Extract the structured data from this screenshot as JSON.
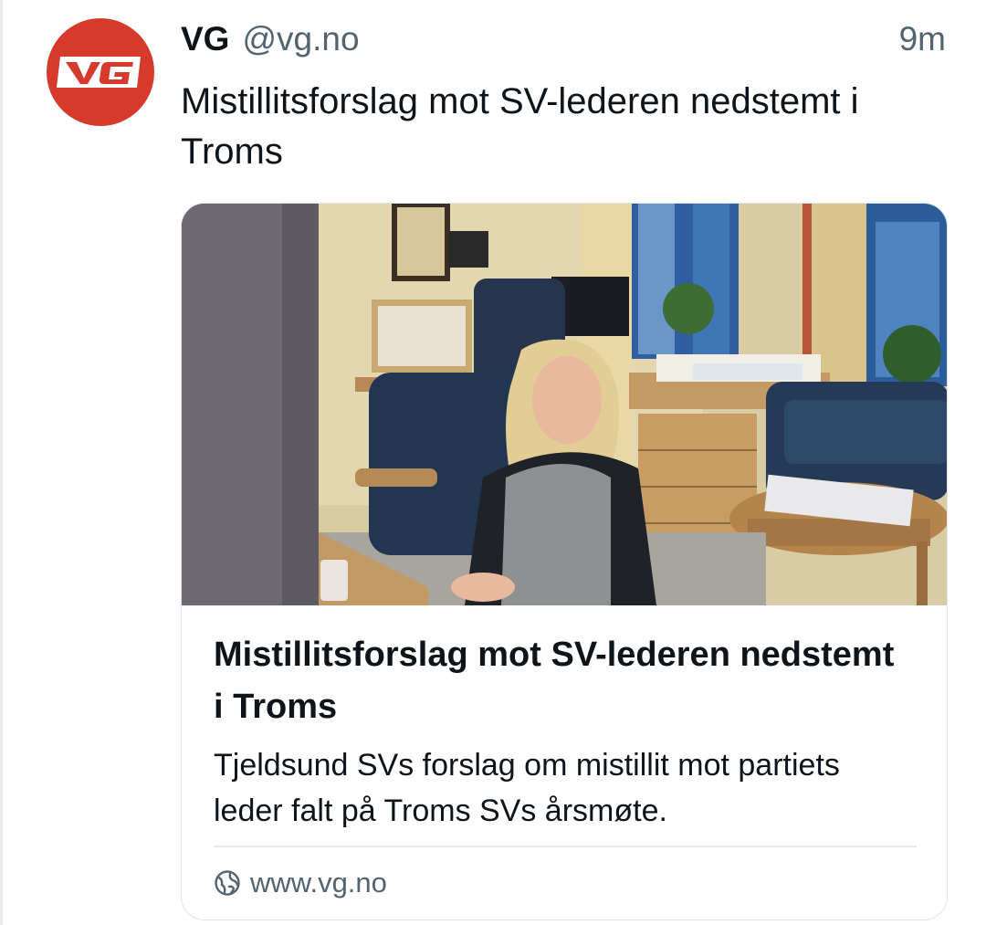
{
  "author": {
    "name": "VG",
    "handle": "@vg.no",
    "avatar_logo": "VG",
    "avatar_color": "#d63a2c"
  },
  "post": {
    "time": "9m",
    "text": "Mistillitsforslag mot SV-lederen nedstemt i Troms"
  },
  "link_card": {
    "image_description_icon": "photo",
    "title": "Mistillitsforslag mot SV-lederen nedstemt i Troms",
    "description": "Tjeldsund SVs forslag om mistillit mot partiets leder falt på Troms SVs årsmøte.",
    "domain": "www.vg.no",
    "domain_icon": "globe-icon"
  },
  "colors": {
    "text": "#0f1419",
    "muted": "#536471",
    "border": "#e1e4e7",
    "brand": "#d63a2c"
  }
}
